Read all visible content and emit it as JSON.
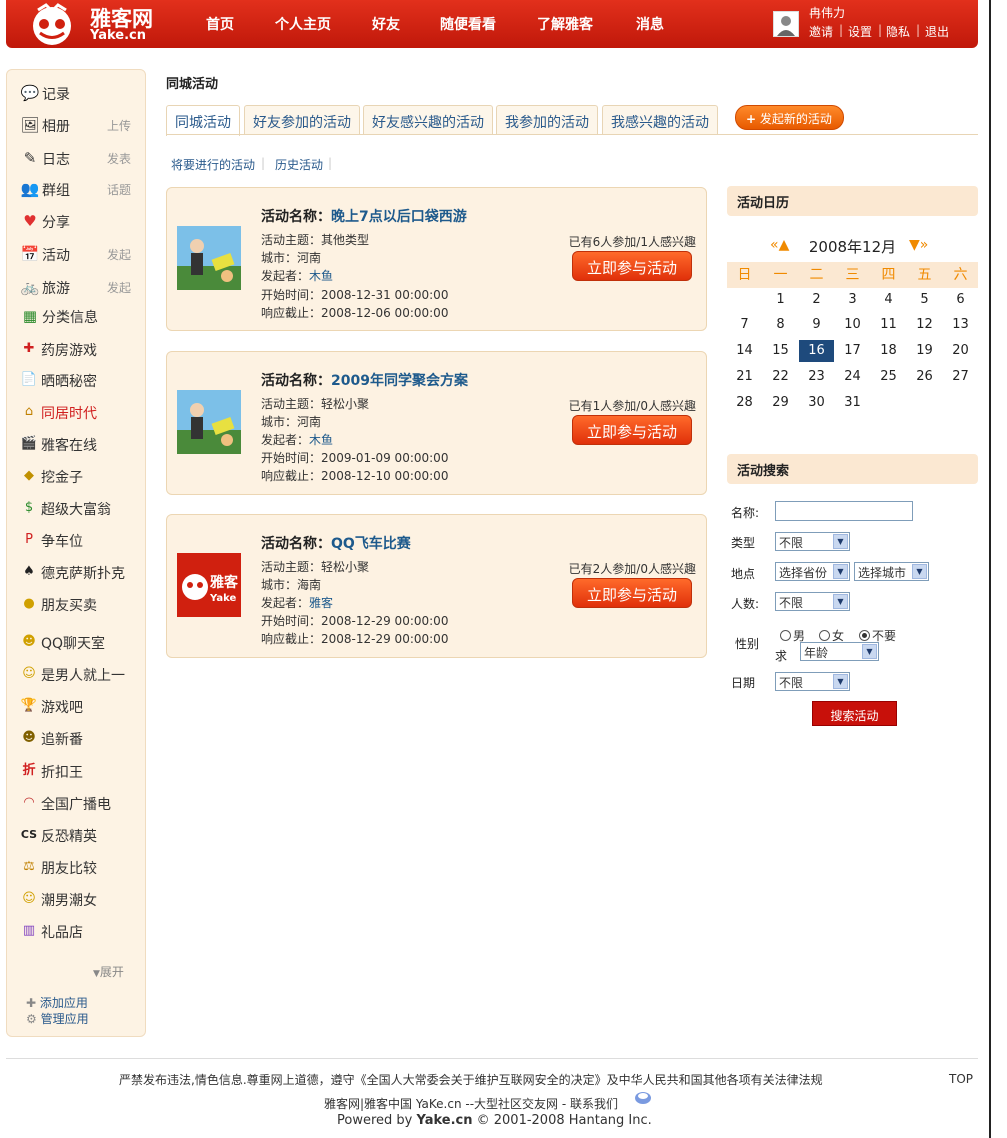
{
  "header": {
    "logo_text": "雅客网",
    "logo_sub": "Yake.cn",
    "nav": [
      "首页",
      "个人主页",
      "好友",
      "随便看看",
      "了解雅客",
      "消息"
    ],
    "username": "冉伟力",
    "user_links": [
      "邀请",
      "设置",
      "隐私",
      "退出"
    ]
  },
  "sidebar": {
    "items": [
      {
        "label": "记录",
        "extra": ""
      },
      {
        "label": "相册",
        "extra": "上传"
      },
      {
        "label": "日志",
        "extra": "发表"
      },
      {
        "label": "群组",
        "extra": "话题"
      },
      {
        "label": "分享",
        "extra": ""
      },
      {
        "label": "活动",
        "extra": "发起"
      },
      {
        "label": "旅游",
        "extra": "发起"
      },
      {
        "label": "分类信息",
        "extra": ""
      }
    ],
    "apps": [
      "药房游戏",
      "晒晒秘密",
      "同居时代",
      "雅客在线",
      "挖金子",
      "超级大富翁",
      "争车位",
      "德克萨斯扑克",
      "朋友买卖"
    ],
    "apps2": [
      "QQ聊天室",
      "是男人就上一",
      "游戏吧",
      "追新番",
      "折扣王",
      "全国广播电",
      "反恐精英",
      "朋友比较",
      "潮男潮女",
      "礼品店"
    ],
    "expand": "展开",
    "add_app": "添加应用",
    "manage_app": "管理应用"
  },
  "main": {
    "title": "同城活动",
    "tabs": [
      "同城活动",
      "好友参加的活动",
      "好友感兴趣的活动",
      "我参加的活动",
      "我感兴趣的活动"
    ],
    "new_button": "发起新的活动",
    "subtabs": [
      "将要进行的活动",
      "历史活动"
    ],
    "name_label": "活动名称：",
    "join_label": "立即参与活动",
    "activities": [
      {
        "name": "晚上7点以后口袋西游",
        "theme": "活动主题：其他类型",
        "city": "城市：河南",
        "organizer_label": "发起者：",
        "organizer": "木鱼",
        "start": "开始时间：2008-12-31 00:00:00",
        "deadline": "响应截止：2008-12-06 00:00:00",
        "stats": "已有6人参加/1人感兴趣"
      },
      {
        "name": "2009年同学聚会方案",
        "theme": "活动主题：轻松小聚",
        "city": "城市：河南",
        "organizer_label": "发起者：",
        "organizer": "木鱼",
        "start": "开始时间：2009-01-09 00:00:00",
        "deadline": "响应截止：2008-12-10 00:00:00",
        "stats": "已有1人参加/0人感兴趣"
      },
      {
        "name": "QQ飞车比赛",
        "theme": "活动主题：轻松小聚",
        "city": "城市：海南",
        "organizer_label": "发起者：",
        "organizer": "雅客",
        "start": "开始时间：2008-12-29 00:00:00",
        "deadline": "响应截止：2008-12-29 00:00:00",
        "stats": "已有2人参加/0人感兴趣"
      }
    ]
  },
  "calendar": {
    "heading": "活动日历",
    "month": "2008年12月",
    "weekdays": [
      "日",
      "一",
      "二",
      "三",
      "四",
      "五",
      "六"
    ],
    "weeks": [
      [
        "",
        "1",
        "2",
        "3",
        "4",
        "5",
        "6"
      ],
      [
        "7",
        "8",
        "9",
        "10",
        "11",
        "12",
        "13"
      ],
      [
        "14",
        "15",
        "16",
        "17",
        "18",
        "19",
        "20"
      ],
      [
        "21",
        "22",
        "23",
        "24",
        "25",
        "26",
        "27"
      ],
      [
        "28",
        "29",
        "30",
        "31",
        "",
        "",
        ""
      ]
    ],
    "today": "16",
    "weekday_color": "#f08a00"
  },
  "search": {
    "heading": "活动搜索",
    "name_label": "名称:",
    "type_label": "类型",
    "type_value": "不限",
    "place_label": "地点",
    "province_value": "选择省份",
    "city_value": "选择城市",
    "count_label": "人数:",
    "count_value": "不限",
    "gender_label": "性别",
    "gender_label2": "求",
    "gender_options": [
      "男",
      "女",
      "不要"
    ],
    "gender_selected": "不要",
    "age_value": "年龄",
    "date_label": "日期",
    "date_value": "不限",
    "button": "搜索活动"
  },
  "footer": {
    "notice": "严禁发布违法,情色信息.尊重网上道德，遵守《全国人大常委会关于维护互联网安全的决定》及中华人民共和国其他各项有关法律法规",
    "top": "TOP",
    "line2": "雅客网|雅客中国 YaKe.cn --大型社区交友网 - 联系我们",
    "powered_prefix": "Powered by ",
    "powered_brand": "Yake.cn",
    "powered_suffix": " © 2001-2008 Hantang Inc."
  },
  "colors": {
    "header_red": "#d0200f",
    "link_blue": "#1e5a8c",
    "today_bg": "#1e4a7c",
    "card_bg": "#fdf2e2"
  }
}
